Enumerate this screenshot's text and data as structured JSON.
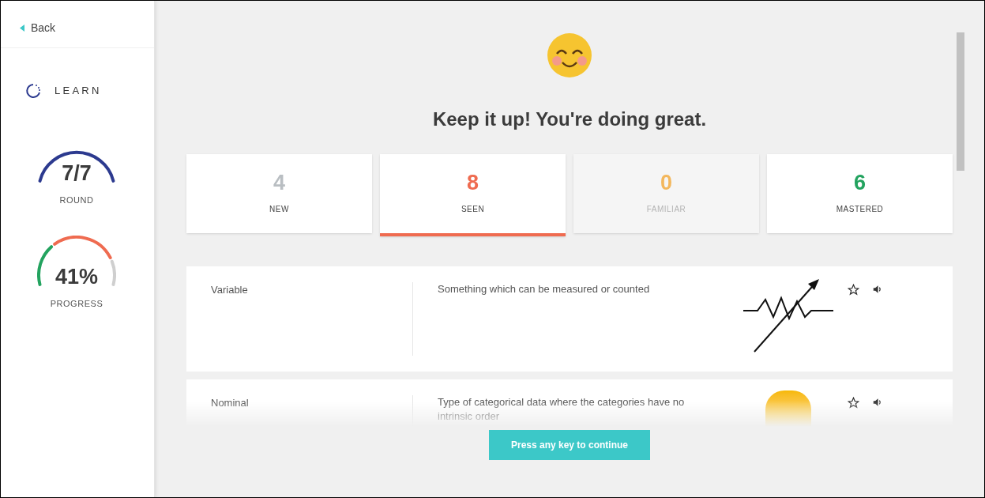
{
  "sidebar": {
    "back": "Back",
    "mode": "LEARN",
    "gauges": [
      {
        "kind": "round",
        "value": "7/7",
        "label": "ROUND"
      },
      {
        "kind": "progress",
        "value": "41%",
        "label": "PROGRESS"
      }
    ]
  },
  "heading": "Keep it up! You're doing great.",
  "stats": [
    {
      "count": "4",
      "label": "NEW",
      "color": "#b9bec2",
      "selected": false,
      "disabled": false
    },
    {
      "count": "8",
      "label": "SEEN",
      "color": "#ef6b50",
      "selected": true,
      "disabled": false
    },
    {
      "count": "0",
      "label": "FAMILIAR",
      "color": "#f3b75c",
      "selected": false,
      "disabled": true
    },
    {
      "count": "6",
      "label": "MASTERED",
      "color": "#23a35f",
      "selected": false,
      "disabled": false
    }
  ],
  "terms": [
    {
      "term": "Variable",
      "definition": "Something which can be measured or counted",
      "kind": "chart"
    },
    {
      "term": "Nominal",
      "definition": "Type of categorical data where the categories have no intrinsic order",
      "kind": "shape"
    }
  ],
  "continue_button": "Press any key to continue"
}
